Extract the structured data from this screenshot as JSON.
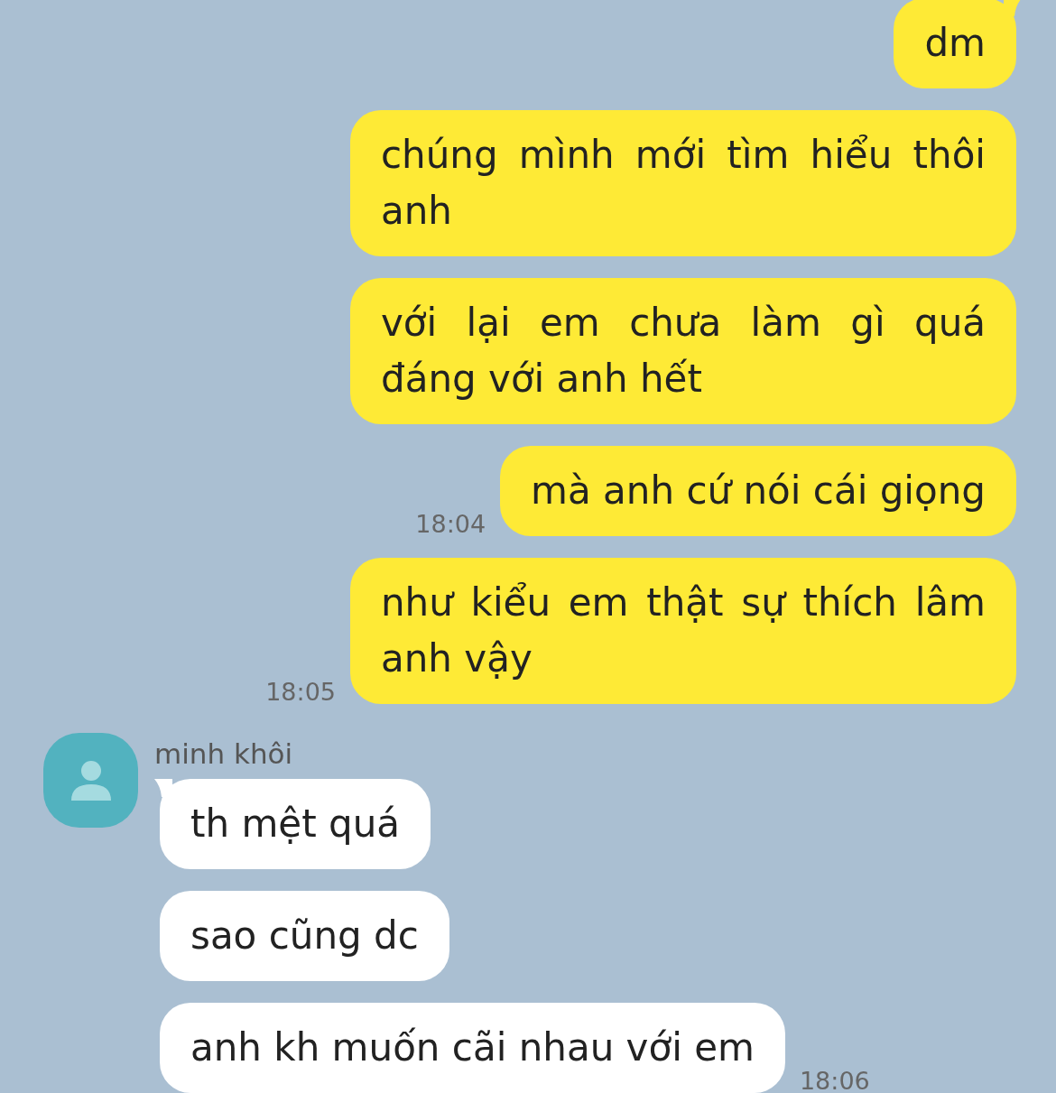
{
  "groups": [
    {
      "kind": "outgoing",
      "messages": [
        {
          "text": "dm"
        },
        {
          "text": "chúng mình mới tìm hiểu thôi anh"
        },
        {
          "text": "với lại em chưa làm gì quá đáng với anh hết"
        },
        {
          "text": "mà anh cứ nói cái giọng",
          "time": "18:04"
        },
        {
          "text": "như kiểu em thật sự thích lâm anh vậy",
          "time": "18:05"
        }
      ]
    },
    {
      "kind": "incoming",
      "sender": "minh khôi",
      "messages": [
        {
          "text": "th mệt quá"
        },
        {
          "text": "sao cũng dc"
        },
        {
          "text": "anh kh muốn cãi nhau với em",
          "time": "18:06"
        }
      ]
    }
  ]
}
